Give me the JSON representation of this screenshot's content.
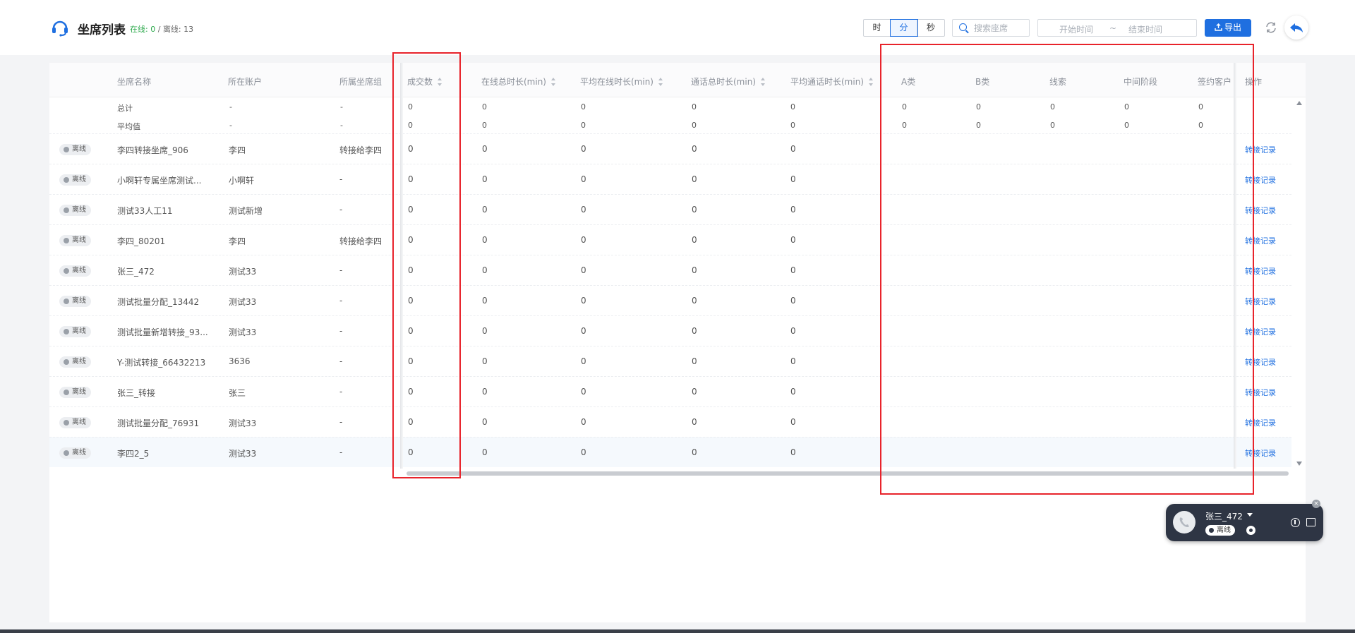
{
  "header": {
    "title": "坐席列表",
    "online_label": "在线:",
    "online_count": "0",
    "divider": "/",
    "offline_label": "离线:",
    "offline_count": "13",
    "time_units": [
      "时",
      "分",
      "秒"
    ],
    "active_unit": "分",
    "search_placeholder": "搜索座席",
    "start_placeholder": "开始时间",
    "range_sep": "~",
    "end_placeholder": "结束时间",
    "export_label": "导出"
  },
  "table": {
    "columns": [
      "坐席名称",
      "所在账户",
      "所属坐席组",
      "成交数",
      "在线总时长(min)",
      "平均在线时长(min)",
      "通话总时长(min)",
      "平均通话时长(min)",
      "A类",
      "B类",
      "线索",
      "中间阶段",
      "签约客户",
      "操作"
    ],
    "sortable": [
      false,
      false,
      false,
      true,
      true,
      true,
      true,
      true,
      false,
      false,
      false,
      false,
      false,
      false
    ],
    "summary": [
      {
        "label": "总计",
        "account": "-",
        "group": "-",
        "values": [
          "0",
          "0",
          "0",
          "0",
          "0",
          "0",
          "0",
          "0",
          "0",
          "0"
        ]
      },
      {
        "label": "平均值",
        "account": "-",
        "group": "-",
        "values": [
          "0",
          "0",
          "0",
          "0",
          "0",
          "0",
          "0",
          "0",
          "0",
          "0"
        ]
      }
    ],
    "status_label": "离线",
    "action_label": "转接记录",
    "rows": [
      {
        "name": "李四转接坐席_906",
        "account": "李四",
        "group": "转接给李四",
        "values": [
          "0",
          "0",
          "0",
          "0",
          "0"
        ]
      },
      {
        "name": "小啊轩专属坐席测试...",
        "account": "小啊轩",
        "group": "-",
        "values": [
          "0",
          "0",
          "0",
          "0",
          "0"
        ]
      },
      {
        "name": "测试33人工11",
        "account": "测试新增",
        "group": "-",
        "values": [
          "0",
          "0",
          "0",
          "0",
          "0"
        ]
      },
      {
        "name": "李四_80201",
        "account": "李四",
        "group": "转接给李四",
        "values": [
          "0",
          "0",
          "0",
          "0",
          "0"
        ]
      },
      {
        "name": "张三_472",
        "account": "测试33",
        "group": "-",
        "values": [
          "0",
          "0",
          "0",
          "0",
          "0"
        ]
      },
      {
        "name": "测试批量分配_13442",
        "account": "测试33",
        "group": "-",
        "values": [
          "0",
          "0",
          "0",
          "0",
          "0"
        ]
      },
      {
        "name": "测试批量新增转接_93...",
        "account": "测试33",
        "group": "-",
        "values": [
          "0",
          "0",
          "0",
          "0",
          "0"
        ]
      },
      {
        "name": "Y-测试转接_66432213",
        "account": "3636",
        "group": "-",
        "values": [
          "0",
          "0",
          "0",
          "0",
          "0"
        ]
      },
      {
        "name": "张三_转接",
        "account": "张三",
        "group": "-",
        "values": [
          "0",
          "0",
          "0",
          "0",
          "0"
        ]
      },
      {
        "name": "测试批量分配_76931",
        "account": "测试33",
        "group": "-",
        "values": [
          "0",
          "0",
          "0",
          "0",
          "0"
        ]
      },
      {
        "name": "李四2_5",
        "account": "测试33",
        "group": "-",
        "values": [
          "0",
          "0",
          "0",
          "0",
          "0"
        ]
      }
    ]
  },
  "phone": {
    "name": "张三_472",
    "status": "离线"
  },
  "colors": {
    "accent": "#1f6fe0",
    "online": "#2aa84a",
    "highlight_box": "#e8232b"
  }
}
